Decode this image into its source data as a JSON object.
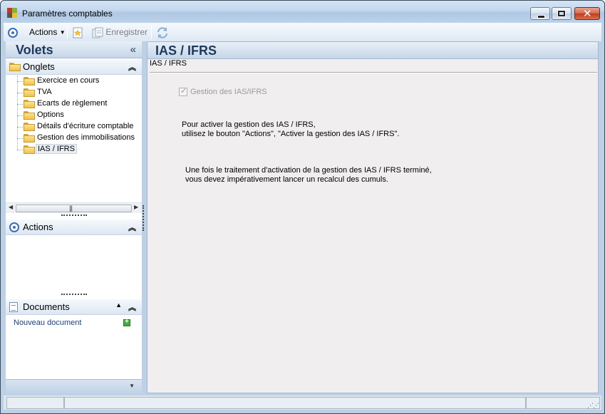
{
  "window": {
    "title": "Paramètres comptables"
  },
  "toolbar": {
    "actions_label": "Actions",
    "save_label": "Enregistrer"
  },
  "left_panel": {
    "title": "Volets",
    "onglets": {
      "title": "Onglets",
      "items": [
        {
          "label": "Exercice en cours"
        },
        {
          "label": "TVA"
        },
        {
          "label": "Ecarts de règlement"
        },
        {
          "label": "Options"
        },
        {
          "label": "Détails d'écriture comptable"
        },
        {
          "label": "Gestion des immobilisations"
        },
        {
          "label": "IAS / IFRS",
          "selected": true
        }
      ]
    },
    "actions": {
      "title": "Actions"
    },
    "documents": {
      "title": "Documents",
      "new_document": "Nouveau document"
    }
  },
  "main": {
    "title": "IAS / IFRS",
    "group_label": "IAS / IFRS",
    "checkbox": {
      "label": "Gestion des IAS/IFRS",
      "checked": true,
      "disabled": true
    },
    "info1": [
      "Pour activer la gestion des IAS / IFRS,",
      "utilisez le bouton \"Actions\", \"Activer la gestion des IAS / IFRS\"."
    ],
    "info2": [
      "Une fois le traitement d'activation de la gestion des IAS / IFRS terminé,",
      "vous devez impérativement lancer un recalcul des cumuls."
    ]
  }
}
